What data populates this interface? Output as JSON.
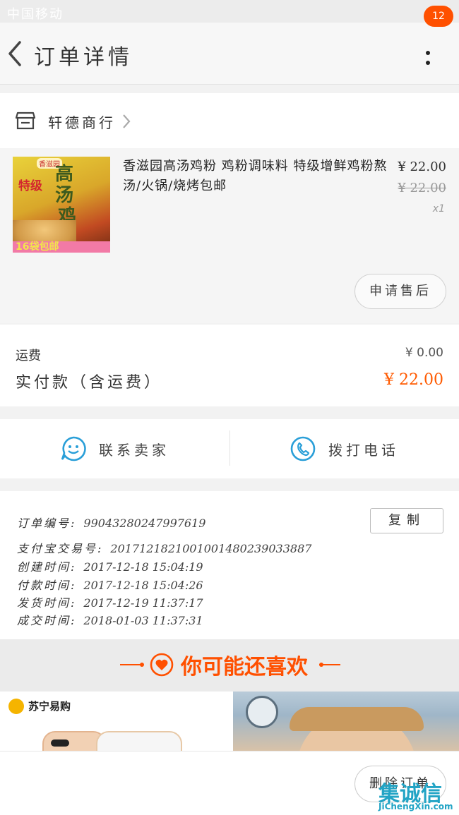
{
  "status_bar": {
    "signal": "中国移动",
    "time": ""
  },
  "nav": {
    "title": "订单详情",
    "badge": "12"
  },
  "shop": {
    "name": "轩德商行"
  },
  "product": {
    "title": "香滋园高汤鸡粉 鸡粉调味料 特级增鲜鸡粉熬汤/火锅/烧烤包邮",
    "price": "¥ 22.00",
    "original_price": "¥ 22.00",
    "quantity": "x1",
    "image_text": {
      "brand": "香滋园",
      "name_top": "高汤",
      "name_bottom": "鸡粉",
      "grade": "特级",
      "promo": "16袋包邮"
    },
    "after_sale_label": "申请售后"
  },
  "fees": {
    "shipping_label": "运费",
    "shipping_value": "¥ 0.00",
    "paid_label": "实付款（含运费）",
    "paid_value": "¥ 22.00"
  },
  "contact": {
    "seller_label": "联系卖家",
    "call_label": "拨打电话"
  },
  "order_info": {
    "copy_label": "复制",
    "rows": [
      {
        "key": "订单编号:",
        "value": "99043280247997619"
      },
      {
        "key": "支付宝交易号:",
        "value": "2017121821001001480239033887"
      },
      {
        "key": "创建时间:",
        "value": "2017-12-18 15:04:19"
      },
      {
        "key": "付款时间:",
        "value": "2017-12-18 15:04:26"
      },
      {
        "key": "发货时间:",
        "value": "2017-12-19 11:37:17"
      },
      {
        "key": "成交时间:",
        "value": "2018-01-03 11:37:31"
      }
    ]
  },
  "recommend": {
    "title": "你可能还喜欢"
  },
  "cards": {
    "left_brand": "苏宁易购"
  },
  "bottom": {
    "delete_label": "删除订单"
  },
  "watermark": {
    "chars": "集诚信",
    "url": "JiChengXin.com"
  },
  "colors": {
    "accent": "#ff5000",
    "link_blue": "#2a9fd8",
    "price_orange": "#ff5a00"
  }
}
